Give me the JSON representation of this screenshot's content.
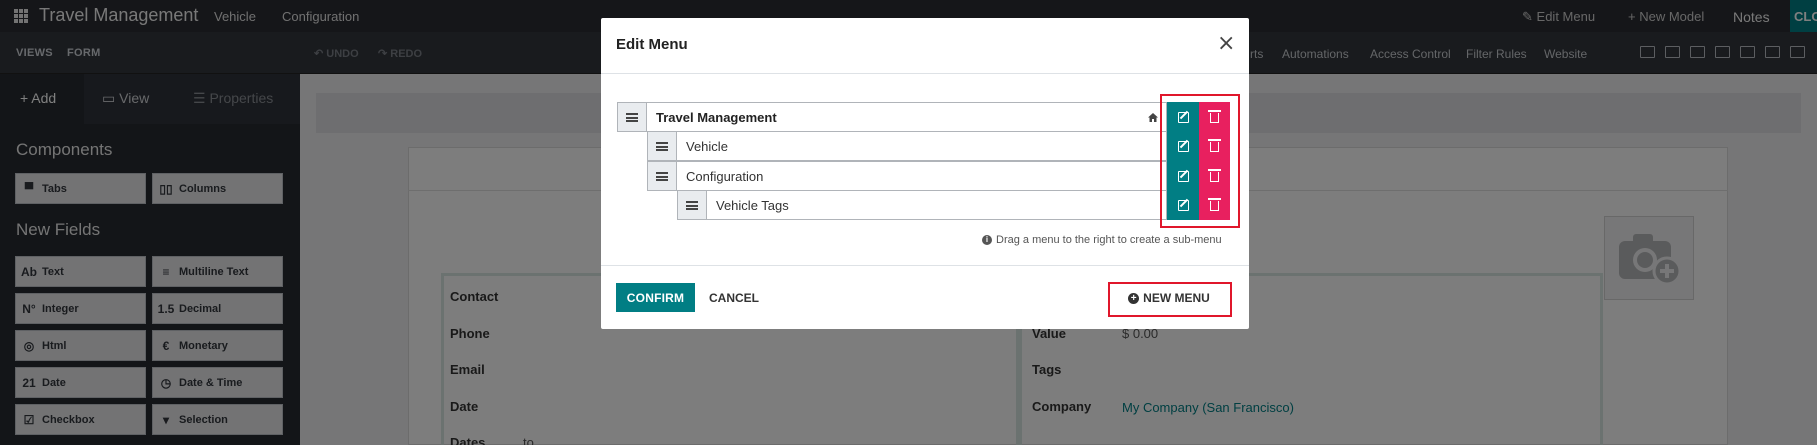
{
  "navbar": {
    "app_title": "Travel Management",
    "menu": [
      "Vehicle",
      "Configuration"
    ],
    "edit_menu": "Edit Menu",
    "new_model": "New Model",
    "notes": "Notes",
    "close_label": "CLOSE"
  },
  "toolbar": {
    "views": "VIEWS",
    "form": "FORM",
    "undo": "UNDO",
    "redo": "REDO",
    "links": [
      "rts",
      "Automations",
      "Access Control",
      "Filter Rules",
      "Website"
    ]
  },
  "sidebar": {
    "tabs": [
      "Add",
      "View",
      "Properties"
    ],
    "components_heading": "Components",
    "components": [
      "Tabs",
      "Columns"
    ],
    "new_fields_heading": "New Fields",
    "fields": [
      {
        "label": "Text",
        "icon": "Ab"
      },
      {
        "label": "Multiline Text",
        "icon": "≡"
      },
      {
        "label": "Integer",
        "icon": "N°"
      },
      {
        "label": "Decimal",
        "icon": "1.5"
      },
      {
        "label": "Html",
        "icon": "◎"
      },
      {
        "label": "Monetary",
        "icon": "€"
      },
      {
        "label": "Date",
        "icon": "21"
      },
      {
        "label": "Date & Time",
        "icon": "◷"
      },
      {
        "label": "Checkbox",
        "icon": "☑"
      },
      {
        "label": "Selection",
        "icon": "▾"
      }
    ]
  },
  "form": {
    "left_labels": [
      "Contact",
      "Phone",
      "Email",
      "Date",
      "Dates"
    ],
    "dates_to": "to",
    "right_labels": [
      "Value",
      "Tags",
      "Company"
    ],
    "value": "$ 0.00",
    "company": "My Company (San Francisco)"
  },
  "modal": {
    "title": "Edit Menu",
    "close_symbol": "×",
    "menu_items": [
      {
        "label": "Travel Management",
        "level": 0,
        "root": true
      },
      {
        "label": "Vehicle",
        "level": 1
      },
      {
        "label": "Configuration",
        "level": 1
      },
      {
        "label": "Vehicle Tags",
        "level": 2
      }
    ],
    "hint": "Drag a menu to the right to create a sub-menu",
    "confirm": "CONFIRM",
    "cancel": "CANCEL",
    "new_menu": "NEW MENU"
  },
  "colors": {
    "primary": "#017e84",
    "danger": "#e8205f",
    "highlight": "#e0162b"
  }
}
